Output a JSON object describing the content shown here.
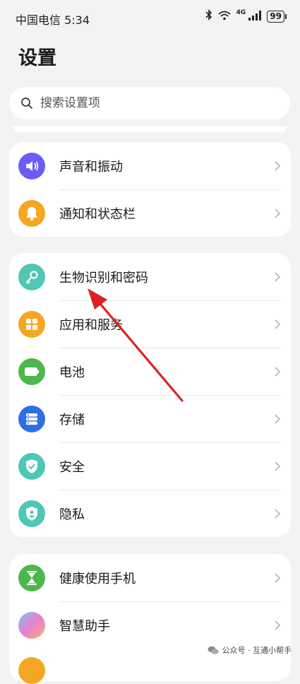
{
  "status_bar": {
    "carrier_time": "中国电信 5:34",
    "network": "4G",
    "battery": "99"
  },
  "page": {
    "title": "设置"
  },
  "search": {
    "placeholder": "搜索设置项"
  },
  "groups": [
    {
      "items": [
        {
          "label": "声音和振动",
          "icon": "sound-icon",
          "color": "#6b5cf6"
        },
        {
          "label": "通知和状态栏",
          "icon": "bell-icon",
          "color": "#f5a623"
        }
      ]
    },
    {
      "items": [
        {
          "label": "生物识别和密码",
          "icon": "key-icon",
          "color": "#4fc7b4"
        },
        {
          "label": "应用和服务",
          "icon": "apps-icon",
          "color": "#f5a623"
        },
        {
          "label": "电池",
          "icon": "battery-icon",
          "color": "#4cb84c"
        },
        {
          "label": "存储",
          "icon": "storage-icon",
          "color": "#2f6fe0"
        },
        {
          "label": "安全",
          "icon": "shield-icon",
          "color": "#4fc7b4"
        },
        {
          "label": "隐私",
          "icon": "privacy-icon",
          "color": "#4fc7b4"
        }
      ]
    },
    {
      "items": [
        {
          "label": "健康使用手机",
          "icon": "hourglass-icon",
          "color": "#4cb84c"
        },
        {
          "label": "智慧助手",
          "icon": "assistant-icon",
          "color": "#e77fd0"
        }
      ]
    }
  ],
  "watermark": {
    "text": "公众号 · 互通小帮手"
  }
}
